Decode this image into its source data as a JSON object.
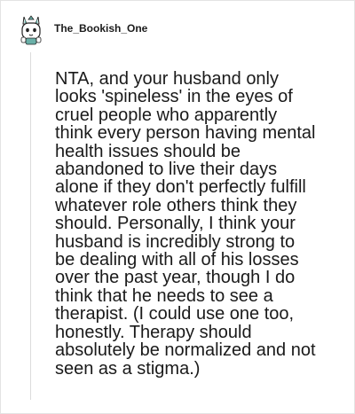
{
  "comment": {
    "username": "The_Bookish_One",
    "avatar_icon": "cartoon-avatar-icon",
    "body": "NTA, and your husband only\nlooks 'spineless' in the eyes of\ncruel people who apparently\nthink every person having mental\nhealth issues should be\nabandoned to live their days\nalone if they don't perfectly fulfill\nwhatever role others think they\nshould. Personally, I think your\nhusband is incredibly strong to\nbe dealing with all of his losses\nover the past year, though I do\nthink that he needs to see a\ntherapist. (I could use one too,\nhonestly. Therapy should\nabsolutely be normalized and not\nseen as a stigma.)"
  },
  "colors": {
    "text": "#1a1a1a",
    "border": "#e3e3e3",
    "thread_line": "#dcdcdc",
    "avatar_accent": "#6ab0a8"
  }
}
